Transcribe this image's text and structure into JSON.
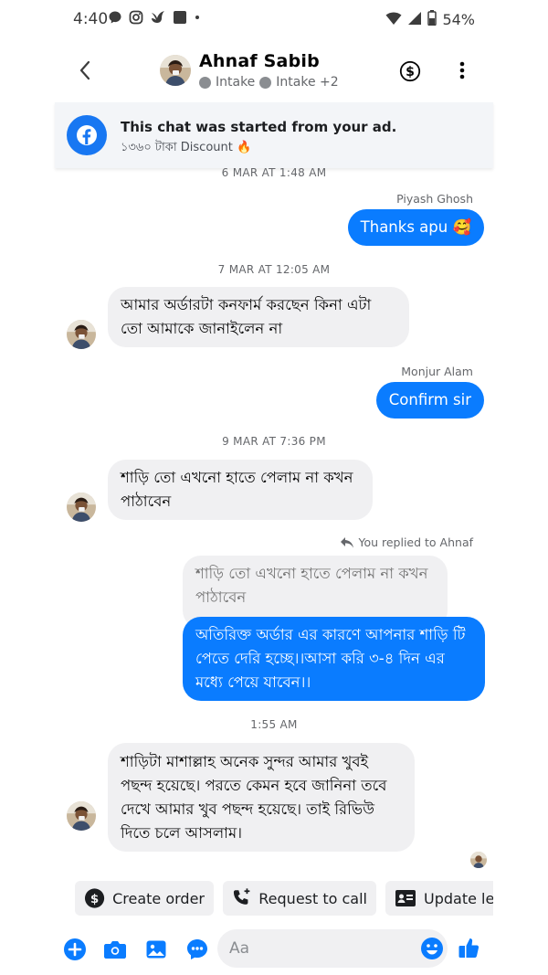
{
  "status_bar": {
    "time": "4:40",
    "battery": "54%"
  },
  "header": {
    "name": "Ahnaf Sabib",
    "tags": [
      "Intake",
      "Intake +2"
    ]
  },
  "ad_banner": {
    "title": "This chat was started from your ad.",
    "subtitle": "১৩৬০ টাকা Discount 🔥"
  },
  "messages": {
    "ts1": "6 MAR AT 1:48 AM",
    "sender1": "Piyash Ghosh",
    "out1": "Thanks apu 🥰",
    "ts2": "7 MAR AT 12:05 AM",
    "in1": "আমার অর্ডারটা  কনফার্ম করছেন কিনা এটা তো আমাকে জানাইলেন না",
    "sender2": "Monjur Alam",
    "out2": "Confirm sir",
    "ts3": "9 MAR AT 7:36 PM",
    "in2": "শাড়ি তো এখনো হাতে পেলাম না কখন পাঠাবেন",
    "reply_note": "You replied to Ahnaf",
    "quoted": "শাড়ি তো এখনো হাতে পেলাম না কখন পাঠাবেন",
    "out3": "অতিরিক্ত অর্ডার এর কারণে আপনার শাড়ি টি পেতে দেরি হচ্ছে।।আসা করি ৩-৪ দিন এর মধ্যে পেয়ে যাবেন।।",
    "ts4": "1:55 AM",
    "in3": "শাড়িটা মাশাল্লাহ অনেক সুন্দর আমার খুবই পছন্দ হয়েছে। পরতে কেমন হবে জানিনা তবে দেখে আমার খুব পছন্দ হয়েছে। তাই রিভিউ দিতে চলে আসলাম।"
  },
  "quick_actions": {
    "create_order": "Create order",
    "request_call": "Request to call",
    "update_lead": "Update le"
  },
  "composer": {
    "placeholder": "Aa"
  },
  "colors": {
    "accent": "#0a7cff",
    "incoming": "#f0f0f2",
    "facebook": "#1877f2"
  }
}
